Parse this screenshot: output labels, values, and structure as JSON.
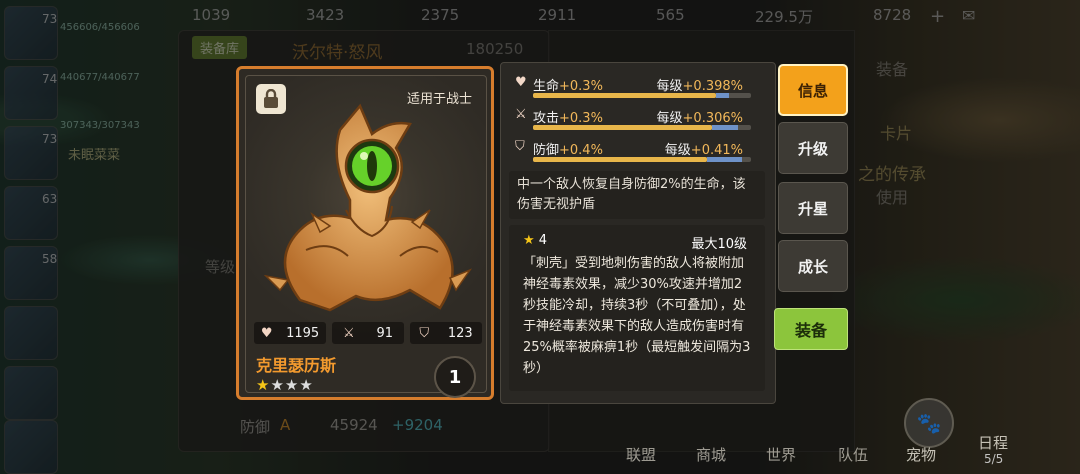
{
  "resources": [
    "1039",
    "3423",
    "2375",
    "2911",
    "565",
    "229.5万",
    "8728"
  ],
  "team_levels": [
    "73",
    "74",
    "73",
    "63",
    "58"
  ],
  "team_hp": [
    "456606/456606",
    "440677/440677",
    "307343/307343"
  ],
  "bg_labels": {
    "equip_tab": "装备库",
    "hero_name": "沃尔特·怒风",
    "power": "180250",
    "grade": "等级",
    "defense_label": "防御",
    "defense_grade": "A",
    "defense_value": "45924",
    "defense_bonus": "+9204",
    "guild_side": "未眠菜菜",
    "side_right_1": "装备",
    "side_right_2": "卡片",
    "side_right_3": "使用",
    "inherit": "之的传承"
  },
  "card": {
    "class_text": "适用于战士",
    "hp": "1195",
    "atk": "91",
    "def": "123",
    "name": "克里瑟历斯",
    "stars": "★★★★",
    "count": "1"
  },
  "stats": [
    {
      "label": "生命",
      "value": "+0.3%",
      "per_label": "每级",
      "per_value": "+0.398%",
      "fill": 0.84,
      "fill2": 0.06
    },
    {
      "label": "攻击",
      "value": "+0.3%",
      "per_label": "每级",
      "per_value": "+0.306%",
      "fill": 0.82,
      "fill2": 0.12
    },
    {
      "label": "防御",
      "value": "+0.4%",
      "per_label": "每级",
      "per_value": "+0.41%",
      "fill": 0.8,
      "fill2": 0.16
    }
  ],
  "passive": "中一个敌人恢复自身防御2%的生命，该伤害无视护盾",
  "skill": {
    "level": "4",
    "max": "最大10级",
    "text": "「刺壳」受到地刺伤害的敌人将被附加神经毒素效果，减少30%攻速并增加2秒技能冷却，持续3秒（不可叠加），处于神经毒素效果下的敌人造成伤害时有25%概率被麻痹1秒（最短触发间隔为3秒）"
  },
  "buttons": {
    "info": "信息",
    "upgrade": "升级",
    "star_up": "升星",
    "growth": "成长",
    "equip": "装备"
  },
  "bottom_nav": [
    "联盟",
    "商城",
    "世界",
    "队伍",
    "宠物",
    "日程"
  ],
  "schedule_count": "5/5",
  "colors": {
    "accent": "#f3a11b",
    "card_border": "#d67d2d",
    "equip_btn": "#8cc53c",
    "name": "#f39a2e"
  }
}
